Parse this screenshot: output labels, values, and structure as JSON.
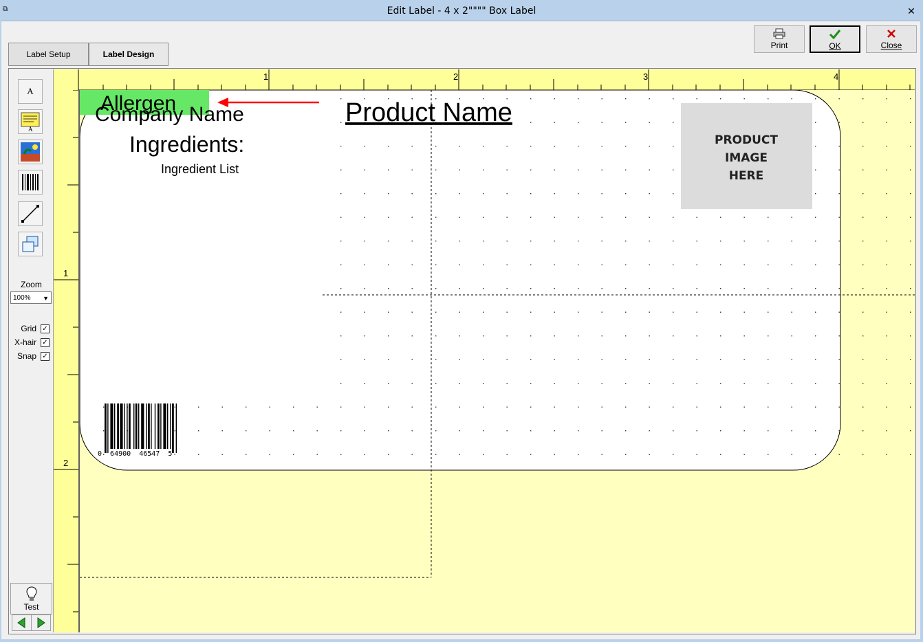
{
  "window": {
    "title": "Edit Label - 4 x 2\"\"\"\" Box Label",
    "close_glyph": "✕"
  },
  "tabs": [
    {
      "label": "Label Setup"
    },
    {
      "label": "Label Design"
    }
  ],
  "actions": {
    "print": "Print",
    "ok": "OK",
    "close": "Close"
  },
  "toolbar": {
    "zoom_label": "Zoom",
    "zoom_value": "100%",
    "grid_label": "Grid",
    "xhair_label": "X-hair",
    "snap_label": "Snap",
    "test_label": "Test"
  },
  "rulers": {
    "top": [
      "1",
      "2",
      "3",
      "4"
    ],
    "left": [
      "1",
      "2"
    ]
  },
  "label": {
    "allergen": "Allergen",
    "company_name": "Company Name",
    "product_name": "Product Name",
    "ingredients_heading": "Ingredients:",
    "ingredient_list": "Ingredient List",
    "image_placeholder": [
      "PRODUCT",
      "IMAGE",
      "HERE"
    ],
    "barcode_digits": "0  64900  46547  5"
  },
  "colors": {
    "allergen_highlight": "#66e866",
    "arrow": "#ff0000",
    "ruler": "#ffff99",
    "canvas": "#ffffc0"
  }
}
